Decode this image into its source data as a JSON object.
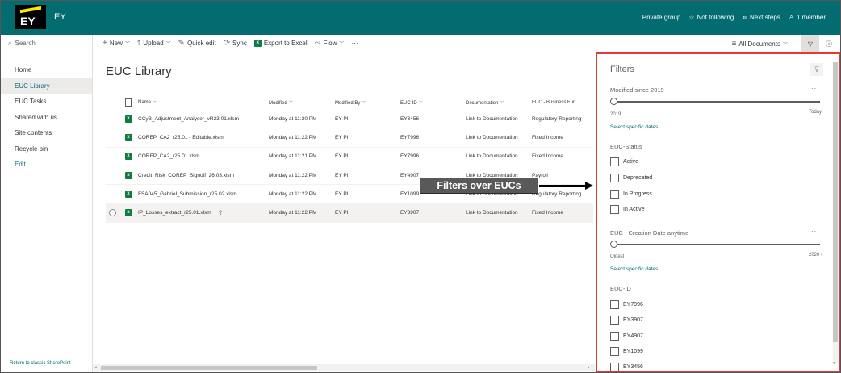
{
  "suite": {
    "logo_text": "EY",
    "site_title": "EY",
    "private_group": "Private group",
    "follow": "Not following",
    "next_steps": "Next steps",
    "members": "1 member"
  },
  "leftnav": {
    "search_placeholder": "Search",
    "items": [
      {
        "label": "Home"
      },
      {
        "label": "EUC Library"
      },
      {
        "label": "EUC Tasks"
      },
      {
        "label": "Shared with us"
      },
      {
        "label": "Site contents"
      },
      {
        "label": "Recycle bin"
      },
      {
        "label": "Edit"
      }
    ],
    "classic_link": "Return to classic SharePoint"
  },
  "commandbar": {
    "new": "New",
    "upload": "Upload",
    "quick_edit": "Quick edit",
    "sync": "Sync",
    "export": "Export to Excel",
    "flow": "Flow",
    "more": "···",
    "view": "All Documents"
  },
  "library": {
    "title": "EUC Library",
    "columns": {
      "name": "Name",
      "modified": "Modified",
      "modified_by": "Modified By",
      "euc_id": "EUC-ID",
      "documentation": "Documentation",
      "business_function": "EUC - Business Fun..."
    },
    "rows": [
      {
        "name": "CCyB_Adjustment_Analyser_vR23.01.xlsm",
        "modified": "Monday at 11:20 PM",
        "by": "EY PI",
        "id": "EY3456",
        "doc": "Link to Documentation",
        "bf": "Regulatory Reporting"
      },
      {
        "name": "COREP_CA2_r25.01 - Editable.xlsm",
        "modified": "Monday at 11:22 PM",
        "by": "EY PI",
        "id": "EY7996",
        "doc": "Link to Documentation",
        "bf": "Fixed Income"
      },
      {
        "name": "COREP_CA2_r25.01.xlsm",
        "modified": "Monday at 11:21 PM",
        "by": "EY PI",
        "id": "EY7996",
        "doc": "Link to Documentation",
        "bf": "Fixed Income"
      },
      {
        "name": "Credit_Risk_COREP_Signoff_26.03.xlsm",
        "modified": "Monday at 11:22 PM",
        "by": "EY PI",
        "id": "EY4907",
        "doc": "Link to Documentation",
        "bf": "Payroll"
      },
      {
        "name": "FSA045_Gabriel_Submission_r25.02.xlsm",
        "modified": "Monday at 11:22 PM",
        "by": "EY PI",
        "id": "EY1099",
        "doc": "Link to Documentation",
        "bf": "Regulatory Reporting"
      },
      {
        "name": "IP_Losses_extract_r25.01.xlsm",
        "modified": "Monday at 11:22 PM",
        "by": "EY PI",
        "id": "EY3907",
        "doc": "Link to Documentation",
        "bf": "Fixed Income"
      }
    ]
  },
  "annotation": {
    "label": "Filters over EUCs"
  },
  "filters": {
    "title": "Filters",
    "modified": {
      "title": "Modified since 2019",
      "left": "2019",
      "right": "Today",
      "link": "Select specific dates"
    },
    "status": {
      "title": "EUC-Status",
      "options": [
        "Active",
        "Deprecated",
        "In Progress",
        "In Active"
      ]
    },
    "creation": {
      "title": "EUC - Creation Date anytime",
      "left": "Oldest",
      "right": "2020+",
      "link": "Select specific dates"
    },
    "euc_id": {
      "title": "EUC-ID",
      "options": [
        "EY7996",
        "EY3907",
        "EY4907",
        "EY1099",
        "EY3456"
      ]
    },
    "more": "···"
  }
}
